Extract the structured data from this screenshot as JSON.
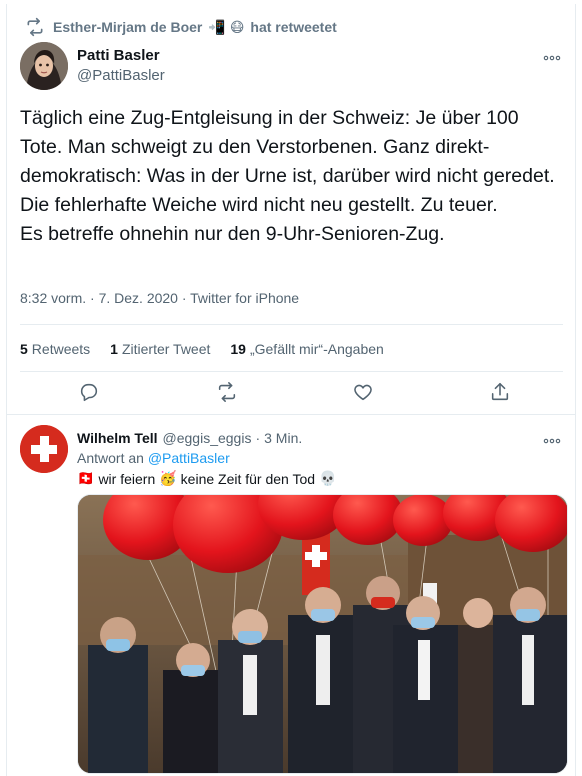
{
  "retweet": {
    "by": "Esther-Mirjam de Boer",
    "emoji_1": "📲",
    "emoji_2": "😷",
    "action": "hat retweetet"
  },
  "tweet": {
    "author_name": "Patti Basler",
    "author_handle": "@PattiBasler",
    "text_lines": [
      "Täglich eine Zug-Entgleisung in der Schweiz: Je über 100 Tote. Man schweigt zu den Verstorbenen. Ganz direkt-demokratisch: Was in der Urne ist, darüber wird nicht geredet.",
      "Die fehlerhafte Weiche wird nicht neu gestellt.  Zu teuer.",
      "Es betreffe ohnehin nur den 9-Uhr-Senioren-Zug."
    ],
    "meta": "8:32 vorm. · 7. Dez. 2020 · Twitter for iPhone",
    "stats": {
      "retweets_count": "5",
      "retweets_label": "Retweets",
      "quotes_count": "1",
      "quotes_label": "Zitierter Tweet",
      "likes_count": "19",
      "likes_label": "„Gefällt mir“-Angaben"
    }
  },
  "reply": {
    "author_name": "Wilhelm Tell",
    "author_handle": "@eggis_eggis",
    "separator": "·",
    "time": "3 Min.",
    "reply_prefix": "Antwort an",
    "reply_to": "@PattiBasler",
    "flag_emoji": "🇨🇭",
    "text_part1": "wir feiern",
    "party_emoji": "🥳",
    "text_part2": "keine Zeit für den Tod",
    "skull_emoji": "💀"
  },
  "icons": {
    "retweet_header": "retweet-icon",
    "more": "more-icon",
    "reply": "reply-icon",
    "retweet": "retweet-icon",
    "like": "heart-icon",
    "share": "share-icon"
  },
  "colors": {
    "link": "#1d9bf0",
    "secondary_text": "#536471",
    "balloon_red": "#e3141c",
    "swiss_red": "#d52b1e"
  }
}
